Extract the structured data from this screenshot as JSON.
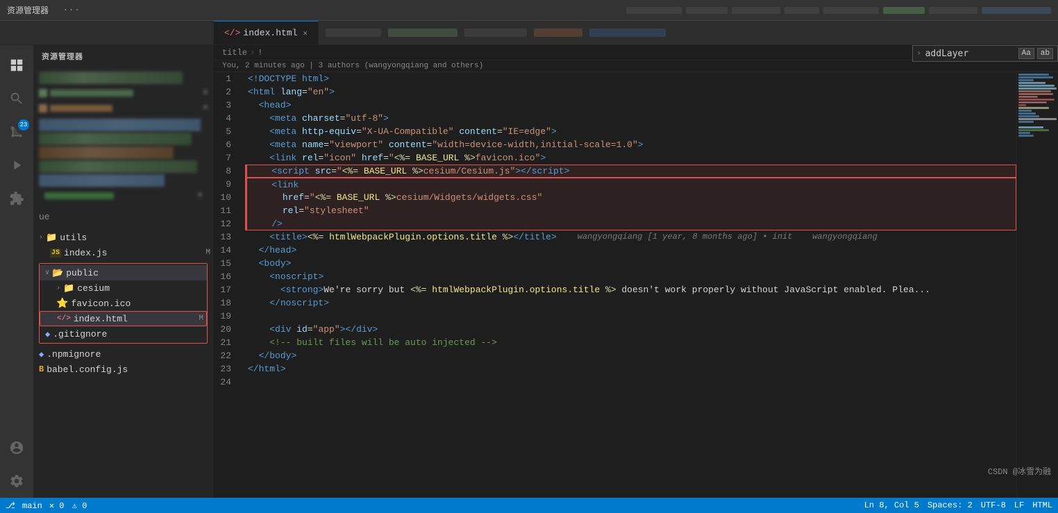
{
  "app": {
    "title": "资源管理器",
    "dots": "···"
  },
  "tabs": [
    {
      "label": "index.html",
      "active": true
    }
  ],
  "breadcrumb": {
    "parts": [
      "title",
      ">",
      "!"
    ]
  },
  "search": {
    "value": "addLayer",
    "placeholder": "addLayer"
  },
  "git_blame": "You, 2 minutes ago | 3 authors (wangyongqiang and others)",
  "code": {
    "lines": [
      {
        "num": 1,
        "content": "<!DOCTYPE html>",
        "type": "doctype"
      },
      {
        "num": 2,
        "content": "<html lang=\"en\">",
        "type": "tag"
      },
      {
        "num": 3,
        "content": "  <head>",
        "type": "tag"
      },
      {
        "num": 4,
        "content": "    <meta charset=\"utf-8\">",
        "type": "tag"
      },
      {
        "num": 5,
        "content": "    <meta http-equiv=\"X-UA-Compatible\" content=\"IE=edge\">",
        "type": "tag"
      },
      {
        "num": 6,
        "content": "    <meta name=\"viewport\" content=\"width=device-width,initial-scale=1.0\">",
        "type": "tag"
      },
      {
        "num": 7,
        "content": "    <link rel=\"icon\" href=\"<%= BASE_URL %>favicon.ico\">",
        "type": "tag"
      },
      {
        "num": 8,
        "content": "    <script src=\"<%= BASE_URL %>cesium/Cesium.js\"></script>",
        "type": "highlight",
        "blame": ""
      },
      {
        "num": 9,
        "content": "    <link",
        "type": "selected"
      },
      {
        "num": 10,
        "content": "      href=\"<%= BASE_URL %>cesium/Widgets/widgets.css\"",
        "type": "selected"
      },
      {
        "num": 11,
        "content": "      rel=\"stylesheet\"",
        "type": "selected"
      },
      {
        "num": 12,
        "content": "    />",
        "type": "selected-last"
      },
      {
        "num": 13,
        "content": "    <title><%= htmlWebpackPlugin.options.title %></title>",
        "type": "tag",
        "blame": "wangyongqiang [1 year, 8 months ago] • init    wangyongqiang"
      },
      {
        "num": 14,
        "content": "  </head>",
        "type": "tag"
      },
      {
        "num": 15,
        "content": "  <body>",
        "type": "tag"
      },
      {
        "num": 16,
        "content": "    <noscript>",
        "type": "tag"
      },
      {
        "num": 17,
        "content": "      <strong>We're sorry but <%= htmlWebpackPlugin.options.title %> doesn't work properly without JavaScript enabled. Please...",
        "type": "tag"
      },
      {
        "num": 18,
        "content": "    </noscript>",
        "type": "tag"
      },
      {
        "num": 19,
        "content": "",
        "type": "empty"
      },
      {
        "num": 20,
        "content": "    <div id=\"app\"></div>",
        "type": "tag"
      },
      {
        "num": 21,
        "content": "    <!-- built files will be auto injected -->",
        "type": "comment"
      },
      {
        "num": 22,
        "content": "  </body>",
        "type": "tag"
      },
      {
        "num": 23,
        "content": "</html>",
        "type": "tag"
      },
      {
        "num": 24,
        "content": "",
        "type": "empty"
      }
    ]
  },
  "sidebar": {
    "title": "资源管理器",
    "tree": [
      {
        "label": "utils",
        "type": "folder",
        "indent": 0
      },
      {
        "label": "index.js",
        "type": "js",
        "indent": 1,
        "suffix": "M"
      },
      {
        "label": "public",
        "type": "folder-open",
        "indent": 0,
        "highlighted": true
      },
      {
        "label": "cesium",
        "type": "folder",
        "indent": 1,
        "highlighted": true
      },
      {
        "label": "favicon.ico",
        "type": "icon-file",
        "indent": 1,
        "highlighted": true
      },
      {
        "label": "index.html",
        "type": "html",
        "indent": 1,
        "highlighted": true,
        "selected": true,
        "suffix": "M"
      },
      {
        "label": ".gitignore",
        "type": "git",
        "indent": 0
      },
      {
        "label": ".npmignore",
        "type": "file",
        "indent": 0
      },
      {
        "label": "babel.config.js",
        "type": "babel",
        "indent": 0
      }
    ]
  },
  "status_bar": {
    "branch": "main",
    "errors": "0",
    "warnings": "0",
    "line": "Ln 8, Col 5",
    "spaces": "Spaces: 2",
    "encoding": "UTF-8",
    "eol": "LF",
    "language": "HTML"
  },
  "watermark": "CSDN @冰雪为融",
  "icons": {
    "files": "🗂",
    "search": "🔍",
    "git": "⎇",
    "debug": "🐛",
    "extensions": "⊞",
    "folder": "📁",
    "folder_open": "📂",
    "js": "JS",
    "html": "</>",
    "git_file": "◆"
  }
}
